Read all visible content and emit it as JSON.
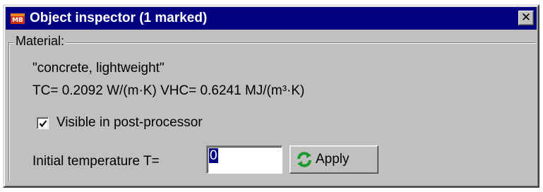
{
  "window": {
    "title": "Object inspector  (1 marked)",
    "app_icon": "app-logo-icon",
    "close_glyph": "✕"
  },
  "material": {
    "group_label": "Material:",
    "name": "\"concrete, lightweight\"",
    "properties": "TC=  0.2092 W/(m·K)    VHC=  0.6241 MJ/(m³·K)"
  },
  "options": {
    "visible_label": "Visible in post-processor",
    "visible_checked": true
  },
  "temperature": {
    "label": "Initial temperature T=",
    "value": "0"
  },
  "apply": {
    "label": "Apply",
    "icon": "refresh-icon"
  },
  "colors": {
    "titlebar": "#000080",
    "face": "#c0c0c0"
  }
}
